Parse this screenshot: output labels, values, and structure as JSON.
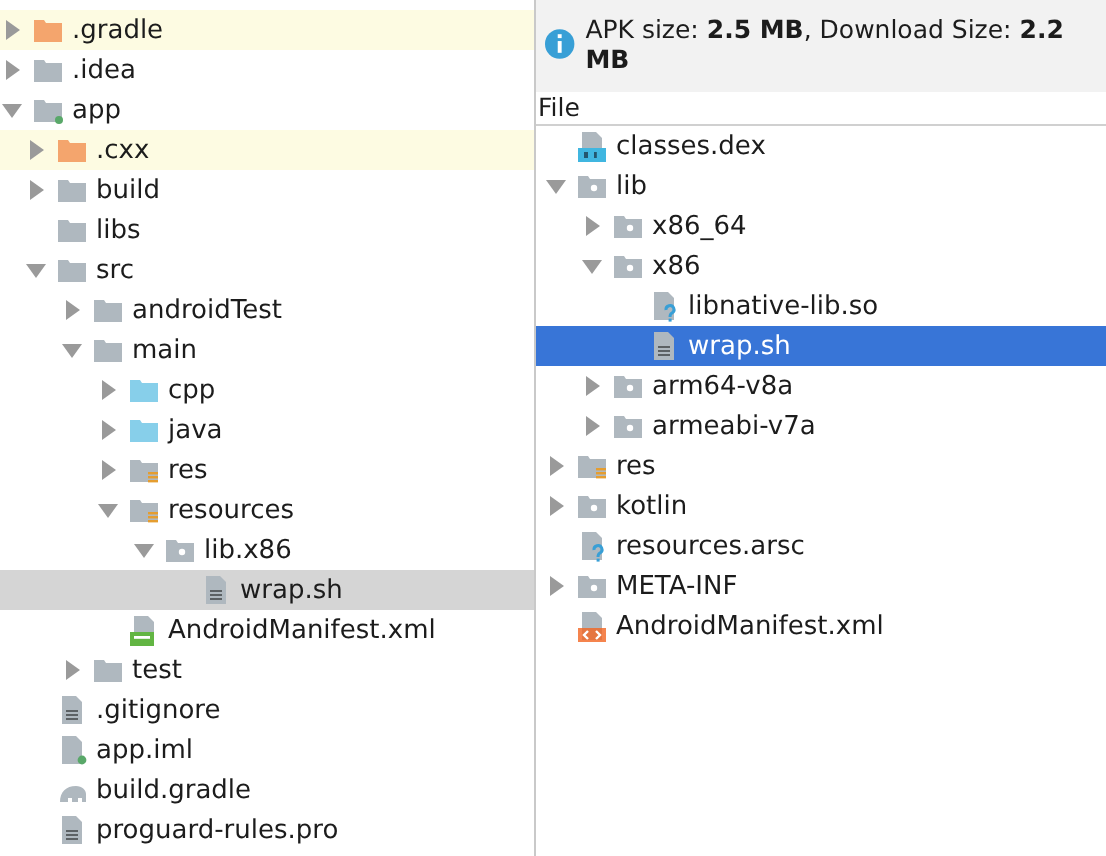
{
  "project_tree": {
    "items": [
      {
        "name": ".gradle",
        "kind": "folder-excluded",
        "expanded": false,
        "highlighted": true,
        "selected": false
      },
      {
        "name": ".idea",
        "kind": "folder",
        "expanded": false,
        "highlighted": false,
        "selected": false
      },
      {
        "name": "app",
        "kind": "folder-module",
        "expanded": true,
        "highlighted": false,
        "selected": false,
        "children": [
          {
            "name": ".cxx",
            "kind": "folder-excluded",
            "expanded": false,
            "highlighted": true,
            "selected": false
          },
          {
            "name": "build",
            "kind": "folder",
            "expanded": false,
            "highlighted": false,
            "selected": false
          },
          {
            "name": "libs",
            "kind": "folder",
            "highlighted": false,
            "selected": false
          },
          {
            "name": "src",
            "kind": "folder",
            "expanded": true,
            "highlighted": false,
            "selected": false,
            "children": [
              {
                "name": "androidTest",
                "kind": "folder",
                "expanded": false,
                "highlighted": false,
                "selected": false
              },
              {
                "name": "main",
                "kind": "folder",
                "expanded": true,
                "highlighted": false,
                "selected": false,
                "children": [
                  {
                    "name": "cpp",
                    "kind": "folder-source",
                    "expanded": false,
                    "highlighted": false,
                    "selected": false
                  },
                  {
                    "name": "java",
                    "kind": "folder-source",
                    "expanded": false,
                    "highlighted": false,
                    "selected": false
                  },
                  {
                    "name": "res",
                    "kind": "folder-res",
                    "expanded": false,
                    "highlighted": false,
                    "selected": false
                  },
                  {
                    "name": "resources",
                    "kind": "folder-res",
                    "expanded": true,
                    "highlighted": false,
                    "selected": false,
                    "children": [
                      {
                        "name": "lib.x86",
                        "kind": "folder-package",
                        "expanded": true,
                        "highlighted": false,
                        "selected": false,
                        "children": [
                          {
                            "name": "wrap.sh",
                            "kind": "file-text",
                            "highlighted": false,
                            "selected": true
                          }
                        ]
                      }
                    ]
                  },
                  {
                    "name": "AndroidManifest.xml",
                    "kind": "file-manifest",
                    "highlighted": false,
                    "selected": false
                  }
                ]
              },
              {
                "name": "test",
                "kind": "folder",
                "expanded": false,
                "highlighted": false,
                "selected": false
              }
            ]
          },
          {
            "name": ".gitignore",
            "kind": "file-text",
            "highlighted": false,
            "selected": false
          },
          {
            "name": "app.iml",
            "kind": "file-module",
            "highlighted": false,
            "selected": false
          },
          {
            "name": "build.gradle",
            "kind": "file-gradle",
            "highlighted": false,
            "selected": false
          },
          {
            "name": "proguard-rules.pro",
            "kind": "file-text",
            "highlighted": false,
            "selected": false
          }
        ]
      }
    ]
  },
  "apk_analyzer": {
    "info": "APK size: **2.5 MB**, Download Size: **2.2 MB**",
    "column_header": "File",
    "items": [
      {
        "name": "classes.dex",
        "kind": "file-dex",
        "highlighted": false,
        "selected": false
      },
      {
        "name": "lib",
        "kind": "folder-package",
        "expanded": true,
        "highlighted": false,
        "selected": false,
        "children": [
          {
            "name": "x86_64",
            "kind": "folder-package",
            "expanded": false,
            "highlighted": false,
            "selected": false
          },
          {
            "name": "x86",
            "kind": "folder-package",
            "expanded": true,
            "highlighted": false,
            "selected": false,
            "children": [
              {
                "name": "libnative-lib.so",
                "kind": "file-unknown",
                "highlighted": false,
                "selected": false
              },
              {
                "name": "wrap.sh",
                "kind": "file-text",
                "highlighted": false,
                "selected": true
              }
            ]
          },
          {
            "name": "arm64-v8a",
            "kind": "folder-package",
            "expanded": false,
            "highlighted": false,
            "selected": false
          },
          {
            "name": "armeabi-v7a",
            "kind": "folder-package",
            "expanded": false,
            "highlighted": false,
            "selected": false
          }
        ]
      },
      {
        "name": "res",
        "kind": "folder-res",
        "expanded": false,
        "highlighted": false,
        "selected": false
      },
      {
        "name": "kotlin",
        "kind": "folder-package",
        "expanded": false,
        "highlighted": false,
        "selected": false
      },
      {
        "name": "resources.arsc",
        "kind": "file-unknown",
        "highlighted": false,
        "selected": false
      },
      {
        "name": "META-INF",
        "kind": "folder-package",
        "expanded": false,
        "highlighted": false,
        "selected": false
      },
      {
        "name": "AndroidManifest.xml",
        "kind": "file-xml",
        "highlighted": false,
        "selected": false
      }
    ]
  }
}
